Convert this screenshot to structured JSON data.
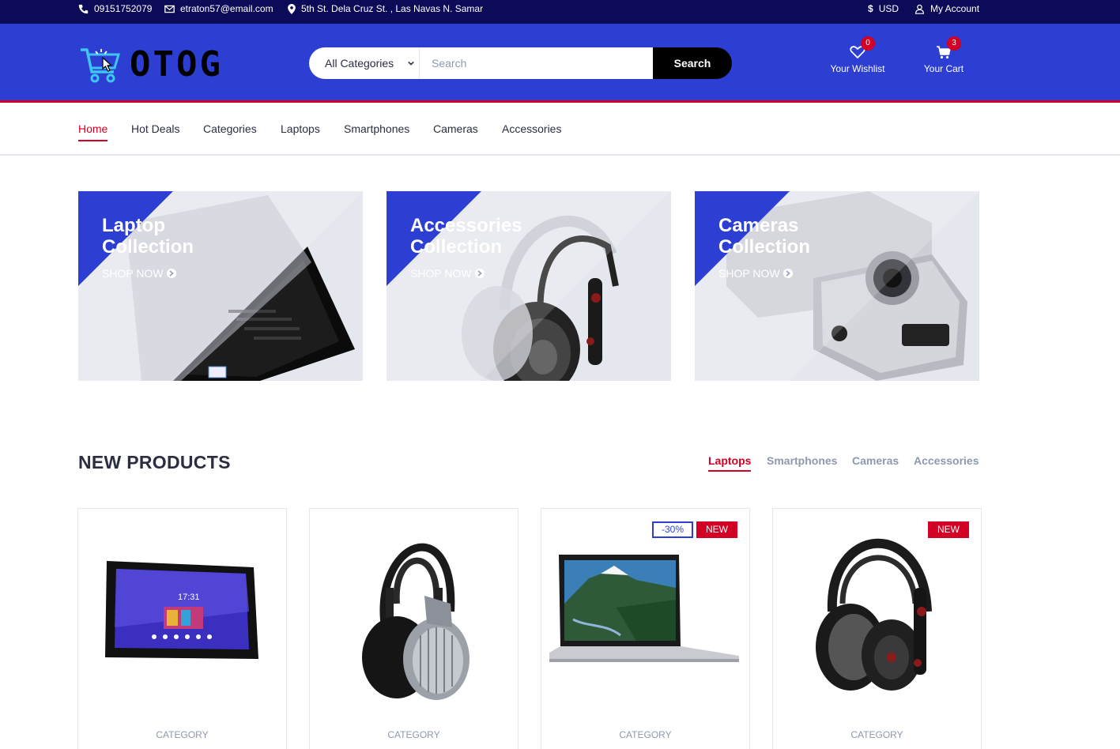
{
  "topbar": {
    "phone": "09151752079",
    "email": "etraton57@email.com",
    "address": "5th St. Dela Cruz St. , Las Navas N. Samar",
    "currency": "USD",
    "account": "My Account"
  },
  "header": {
    "logo_text": "OTOG",
    "category_select": "All Categories",
    "search_placeholder": "Search",
    "search_button": "Search",
    "wishlist_label": "Your Wishlist",
    "wishlist_count": "0",
    "cart_label": "Your Cart",
    "cart_count": "3"
  },
  "nav": {
    "items": [
      "Home",
      "Hot Deals",
      "Categories",
      "Laptops",
      "Smartphones",
      "Cameras",
      "Accessories"
    ],
    "active": "Home"
  },
  "collections": [
    {
      "line1": "Laptop",
      "line2": "Collection",
      "link": "SHOP NOW"
    },
    {
      "line1": "Accessories",
      "line2": "Collection",
      "link": "SHOP NOW"
    },
    {
      "line1": "Cameras",
      "line2": "Collection",
      "link": "SHOP NOW"
    }
  ],
  "new_products": {
    "title": "NEW PRODUCTS",
    "tabs": [
      "Laptops",
      "Smartphones",
      "Cameras",
      "Accessories"
    ],
    "active_tab": "Laptops",
    "cards": [
      {
        "category": "CATEGORY",
        "image": "tablet",
        "sale": "",
        "new": ""
      },
      {
        "category": "CATEGORY",
        "image": "headphones-silver",
        "sale": "",
        "new": ""
      },
      {
        "category": "CATEGORY",
        "image": "laptop",
        "sale": "-30%",
        "new": "NEW"
      },
      {
        "category": "CATEGORY",
        "image": "headphones-black",
        "sale": "",
        "new": "NEW"
      }
    ]
  },
  "colors": {
    "topbar": "#0b0b58",
    "header": "#2d3fd3",
    "accent": "#d10024",
    "text": "#2b2d42",
    "muted": "#8d99ae"
  }
}
